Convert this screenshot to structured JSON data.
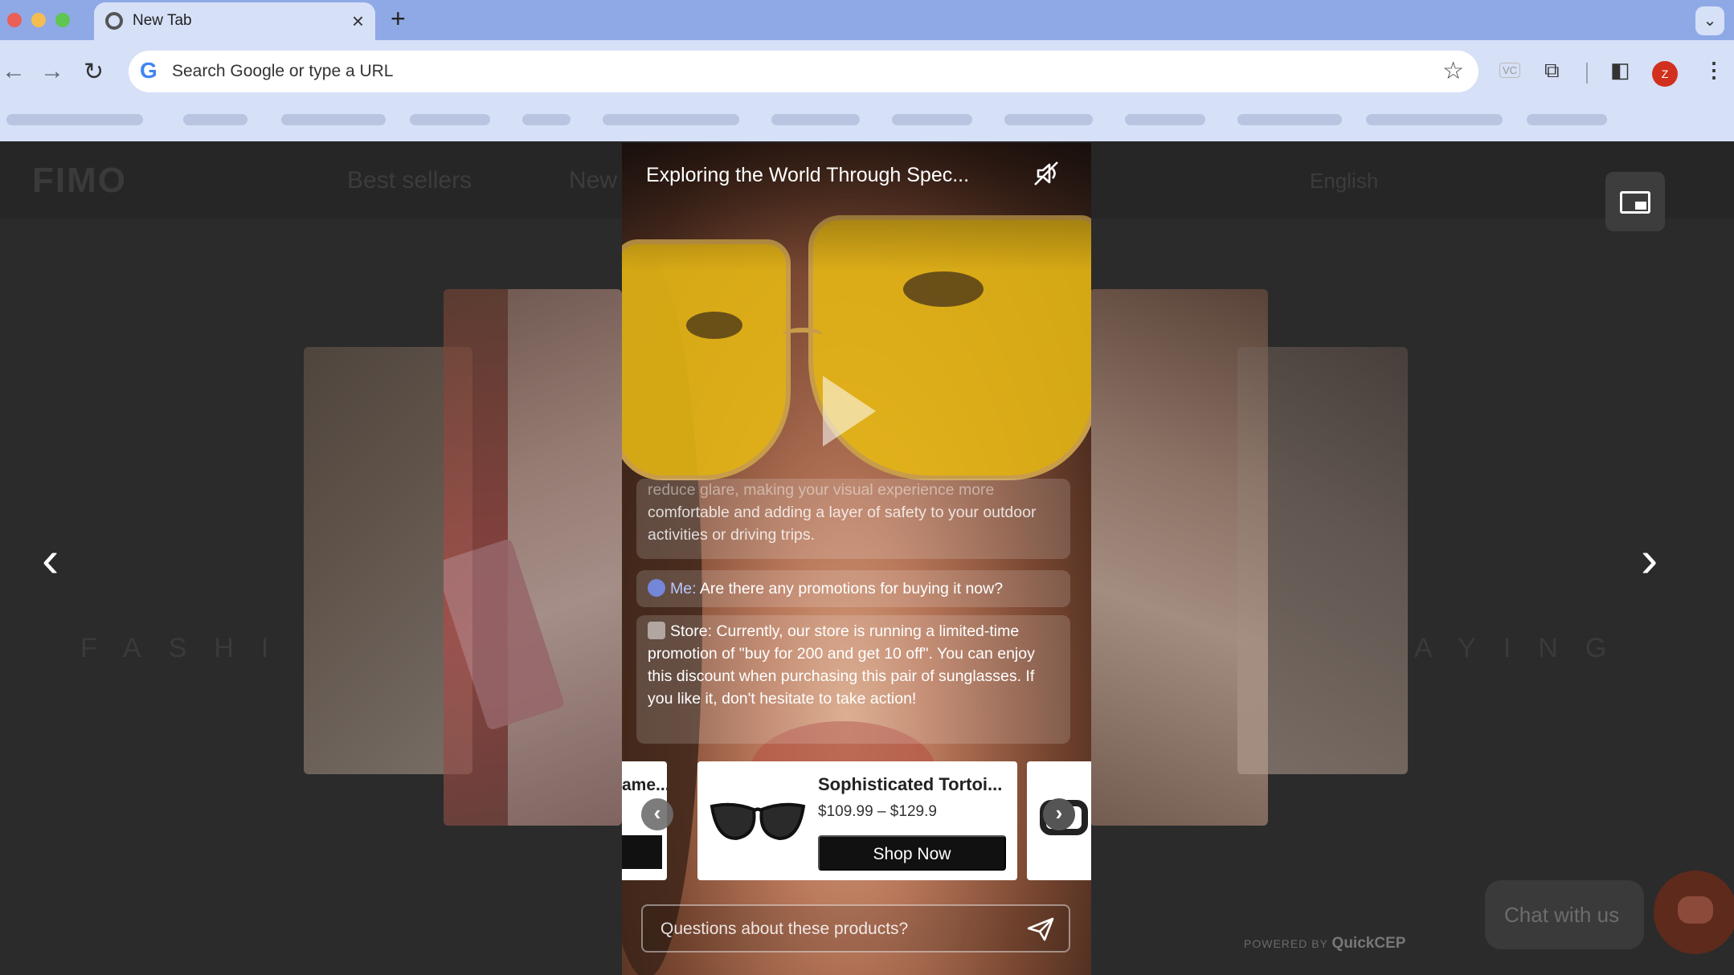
{
  "browser": {
    "tab_title": "New Tab",
    "new_tab_symbol": "+",
    "omnibox_placeholder": "Search Google or type a URL",
    "avatar_letter": "Z",
    "ext_badge": "VC"
  },
  "site": {
    "logo": "FIMO",
    "nav": [
      "Best sellers",
      "New"
    ],
    "language": "English",
    "side_word_left": "FASHI",
    "side_word_right": "AYING",
    "chat_button": "Chat with us",
    "powered_by": "POWERED BY",
    "powered_brand": "QuickCEP"
  },
  "video": {
    "title": "Exploring the World Through Spec...",
    "messages": {
      "previous_text_faded": "reduce glare, making your visual experience more",
      "previous_text": "comfortable and adding a layer of safety to your outdoor activities or driving trips.",
      "me_label": "Me:",
      "me_text": "Are there any promotions for buying it now?",
      "store_label": "Store:",
      "store_text": "Currently, our store is running a limited-time promotion of \"buy for 200 and get 10 off\". You can enjoy this discount when purchasing this pair of sunglasses. If you like it, don't hesitate to take action!"
    },
    "products": {
      "prev_partial_name": "ame...",
      "main_name": "Sophisticated Tortoi...",
      "main_price": "$109.99 – $129.9",
      "shop_button": "Shop Now"
    },
    "ask_placeholder": "Questions about these products?"
  },
  "icons": {
    "back": "arrow-left-icon",
    "forward": "arrow-right-icon",
    "reload": "reload-icon",
    "star": "bookmark-star-icon",
    "extensions": "puzzle-icon",
    "side_panel": "side-panel-icon",
    "menu": "kebab-menu-icon",
    "mute": "mute-speaker-icon",
    "send": "send-icon",
    "pip": "picture-in-picture-icon",
    "play": "play-icon"
  }
}
